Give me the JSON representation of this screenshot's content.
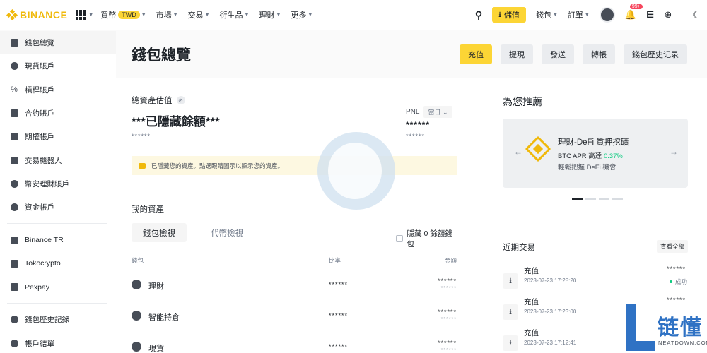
{
  "colors": {
    "brand": "#F0B90B",
    "primary_button": "#FCD535",
    "success": "#0ECB81",
    "badge": "#F6465D"
  },
  "topnav": {
    "logo_text": "BINANCE",
    "items": [
      {
        "label": "買幣",
        "badge": "TWD"
      },
      {
        "label": "市場"
      },
      {
        "label": "交易"
      },
      {
        "label": "衍生品"
      },
      {
        "label": "理財"
      },
      {
        "label": "更多"
      }
    ],
    "deposit_label": "儲值",
    "wallet_label": "錢包",
    "orders_label": "訂單",
    "notification_count": "99+"
  },
  "sidebar": {
    "items": [
      {
        "label": "錢包總覽",
        "icon": "dashboard-icon"
      },
      {
        "label": "現貨賬戶",
        "icon": "spot-icon"
      },
      {
        "label": "槓桿賬戶",
        "icon": "percent-icon"
      },
      {
        "label": "合約賬戶",
        "icon": "futures-icon"
      },
      {
        "label": "期權帳戶",
        "icon": "options-icon"
      },
      {
        "label": "交易機器人",
        "icon": "robot-icon"
      },
      {
        "label": "幣安理財賬戶",
        "icon": "earn-icon"
      },
      {
        "label": "資金帳戶",
        "icon": "funding-icon"
      },
      {
        "label": "Binance TR",
        "icon": "exchange-icon"
      },
      {
        "label": "Tokocrypto",
        "icon": "exchange-icon"
      },
      {
        "label": "Pexpay",
        "icon": "exchange-icon"
      },
      {
        "label": "錢包歷史記錄",
        "icon": "history-icon"
      },
      {
        "label": "帳戶結單",
        "icon": "statement-icon"
      }
    ]
  },
  "header": {
    "title": "錢包總覽",
    "buttons": [
      "充值",
      "提現",
      "發送",
      "轉帳",
      "錢包歷史记录"
    ]
  },
  "balance": {
    "label": "總資產估值",
    "hidden_amount": "***已隱藏餘額***",
    "hidden_sub": "******",
    "pnl_label": "PNL",
    "pnl_period": "當日",
    "pnl_value": "******",
    "pnl_sub": "******",
    "notice": "已隱藏您的資產。點選眼睛圖示以顯示您的資產。"
  },
  "assets": {
    "title": "我的資產",
    "tabs": [
      "錢包檢視",
      "代幣檢視"
    ],
    "hide_zero_label": "隱藏 0 餘額錢包",
    "columns": [
      "錢包",
      "比率",
      "金額"
    ],
    "rows": [
      {
        "name": "理財",
        "ratio": "******",
        "amount": "******",
        "amount_sub": "******"
      },
      {
        "name": "智能持倉",
        "ratio": "******",
        "amount": "******",
        "amount_sub": "******"
      },
      {
        "name": "現貨",
        "ratio": "******",
        "amount": "******",
        "amount_sub": "******"
      }
    ]
  },
  "recommend": {
    "title": "為您推薦",
    "card_title": "理財-DeFi 質押挖礦",
    "apr_prefix": "BTC APR 高達",
    "apr_value": "0.37%",
    "card_sub": "輕鬆把握 DeFi 機會"
  },
  "recent": {
    "title": "近期交易",
    "view_all": "查看全部",
    "items": [
      {
        "type": "充值",
        "time": "2023-07-23 17:28:20",
        "amount": "******",
        "status": "成功"
      },
      {
        "type": "充值",
        "time": "2023-07-23 17:23:00",
        "amount": "******",
        "status": ""
      },
      {
        "type": "充值",
        "time": "2023-07-23 17:12:41",
        "amount": "",
        "status": ""
      }
    ]
  },
  "watermark": {
    "text": "链懂",
    "sub": "NEATDOWN.COM"
  }
}
